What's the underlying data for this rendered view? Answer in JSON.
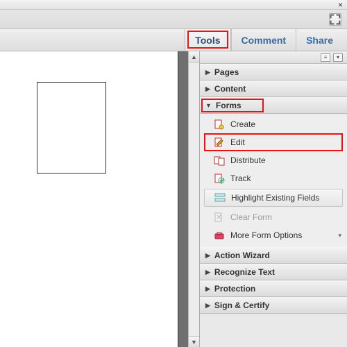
{
  "tabs": {
    "tools": "Tools",
    "comment": "Comment",
    "share": "Share"
  },
  "sections": {
    "pages": "Pages",
    "content": "Content",
    "forms": "Forms",
    "action_wizard": "Action Wizard",
    "recognize_text": "Recognize Text",
    "protection": "Protection",
    "sign_certify": "Sign & Certify"
  },
  "forms_items": {
    "create": "Create",
    "edit": "Edit",
    "distribute": "Distribute",
    "track": "Track",
    "highlight": "Highlight Existing Fields",
    "clear": "Clear Form",
    "more": "More Form Options"
  }
}
